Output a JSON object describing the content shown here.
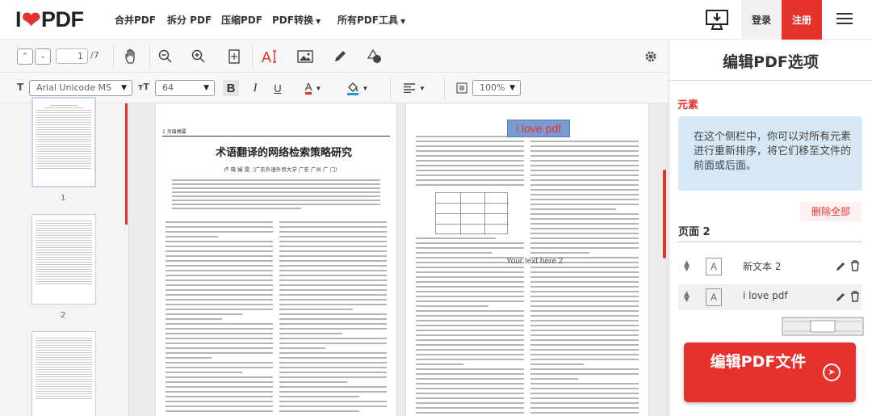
{
  "logo": {
    "i": "I",
    "pdf": "PDF"
  },
  "nav": {
    "items": [
      {
        "label": "合并PDF",
        "has_caret": false
      },
      {
        "label": "拆分 PDF",
        "has_caret": false
      },
      {
        "label": "压缩PDF",
        "has_caret": false
      },
      {
        "label": "PDF转换",
        "has_caret": true
      },
      {
        "label": "所有PDF工具",
        "has_caret": true
      }
    ],
    "login": "登录",
    "register": "注册"
  },
  "toolbar": {
    "page_current": "1",
    "page_total": "/7",
    "font_label": "T",
    "font_family": "Arial Unicode MS",
    "size_label": "ᴛT",
    "font_size": "64",
    "bold": "B",
    "italic": "I",
    "underline": "U",
    "color_a": "A",
    "opacity": "100%"
  },
  "thumbnails": [
    {
      "number": "1"
    },
    {
      "number": "2"
    },
    {
      "number": ""
    }
  ],
  "document": {
    "page1_corner": "1 页眉摘要",
    "page1_title": "术语翻译的网络检索策略研究",
    "page1_authors": "卢 晓 娟 雯（广东外语外贸大学 广东 广州 广 门）",
    "page2_edited_text": "i love pdf",
    "page2_new_text": "Your text here 2"
  },
  "panel": {
    "title": "编辑PDF选项",
    "section_label": "元素",
    "info": "在这个侧栏中，你可以对所有元素进行重新排序，将它们移至文件的前面或后面。",
    "delete_all": "删除全部",
    "page_label": "页面 2",
    "elements": [
      {
        "icon": "A",
        "name": "新文本 2"
      },
      {
        "icon": "A",
        "name": "i love pdf"
      }
    ],
    "cta_label": "编辑PDF文件"
  },
  "colors": {
    "brand": "#e5322d",
    "info_bg": "#d6e8f5",
    "highlight": "#7a9bd0"
  }
}
